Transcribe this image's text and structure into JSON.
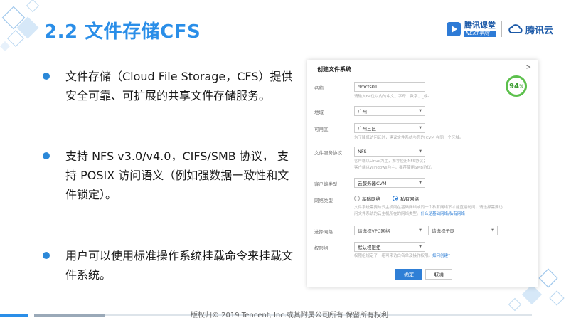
{
  "slide": {
    "title": "2.2 文件存储CFS",
    "footer": "版权归© 2019 Tencent, Inc.或其附属公司所有 保留所有权利"
  },
  "logos": {
    "logo1_cn": "腾讯课堂",
    "logo1_en": "NEXT学院",
    "logo2": "腾讯云"
  },
  "bullets": [
    "文件存储（Cloud File Storage，CFS）提供安全可靠、可扩展的共享文件存储服务。",
    "支持 NFS v3.0/v4.0，CIFS/SMB 协议， 支持 POSIX 访问语义（例如强数据一致性和文件锁定）。",
    "用户可以使用标准操作系统挂载命令来挂载文件系统。"
  ],
  "form": {
    "title": "创建文件系统",
    "close": ">",
    "badge": "94",
    "badge_unit": "%",
    "name_label": "名称",
    "name_value": "dmcfs01",
    "name_hint": "请输入64位以内的中文、字母、数字、_或-",
    "region_label": "地域",
    "region_value": "广州",
    "zone_label": "可用区",
    "zone_value": "广州三区",
    "zone_hint": "为了降低访问延时，建议文件系统与您的 CVM 在同一个区域。",
    "protocol_label": "文件服务协议",
    "protocol_value": "NFS",
    "protocol_hint1": "客户端以Linux为主，推荐使用NFS协议；",
    "protocol_hint2": "客户端以Windows为主，推荐使用SMB协议。",
    "client_label": "客户端类型",
    "client_value": "云服务器CVM",
    "network_type_label": "网络类型",
    "network_basic": "基础网络",
    "network_private": "私有网络",
    "network_hint1": "文件系统需要与云主机同在基础网络或同一个私有网络下才能直接访问，请选择需要访",
    "network_hint2": "问文件系统的云主机所在的网络类型。",
    "network_link": "什么是基础网络/私有网络",
    "select_network_label": "选择网络",
    "vpc_placeholder": "请选择VPC网络",
    "subnet_placeholder": "请选择子网",
    "permission_label": "权限组",
    "permission_value": "默认权限组",
    "permission_hint": "权限组规定了一组可来访白名单及操作权限。",
    "permission_link": "如何创建?",
    "ok": "确定",
    "cancel": "取消"
  },
  "colors": {
    "accent": "#2a8ee8",
    "bullet": "#2b88d8",
    "primary_button": "#2f7fd6",
    "badge_ring": "#5cc04c"
  }
}
